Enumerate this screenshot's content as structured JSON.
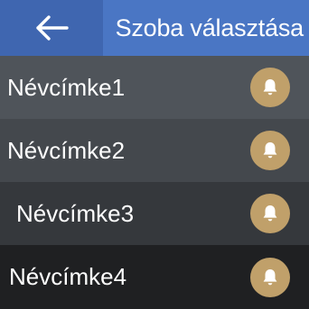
{
  "header": {
    "title": "Szoba választása",
    "back_icon": "arrow-left-icon"
  },
  "rooms": [
    {
      "label": "Névcímke1",
      "icon": "bell-icon"
    },
    {
      "label": "Névcímke2",
      "icon": "bell-icon"
    },
    {
      "label": "Névcímke3",
      "icon": "bell-icon"
    },
    {
      "label": "Névcímke4",
      "icon": "bell-icon"
    }
  ],
  "colors": {
    "header_blue": "#4a76c4",
    "back_button_blue": "#3f66b0",
    "bell_gold": "#c0a06a"
  }
}
